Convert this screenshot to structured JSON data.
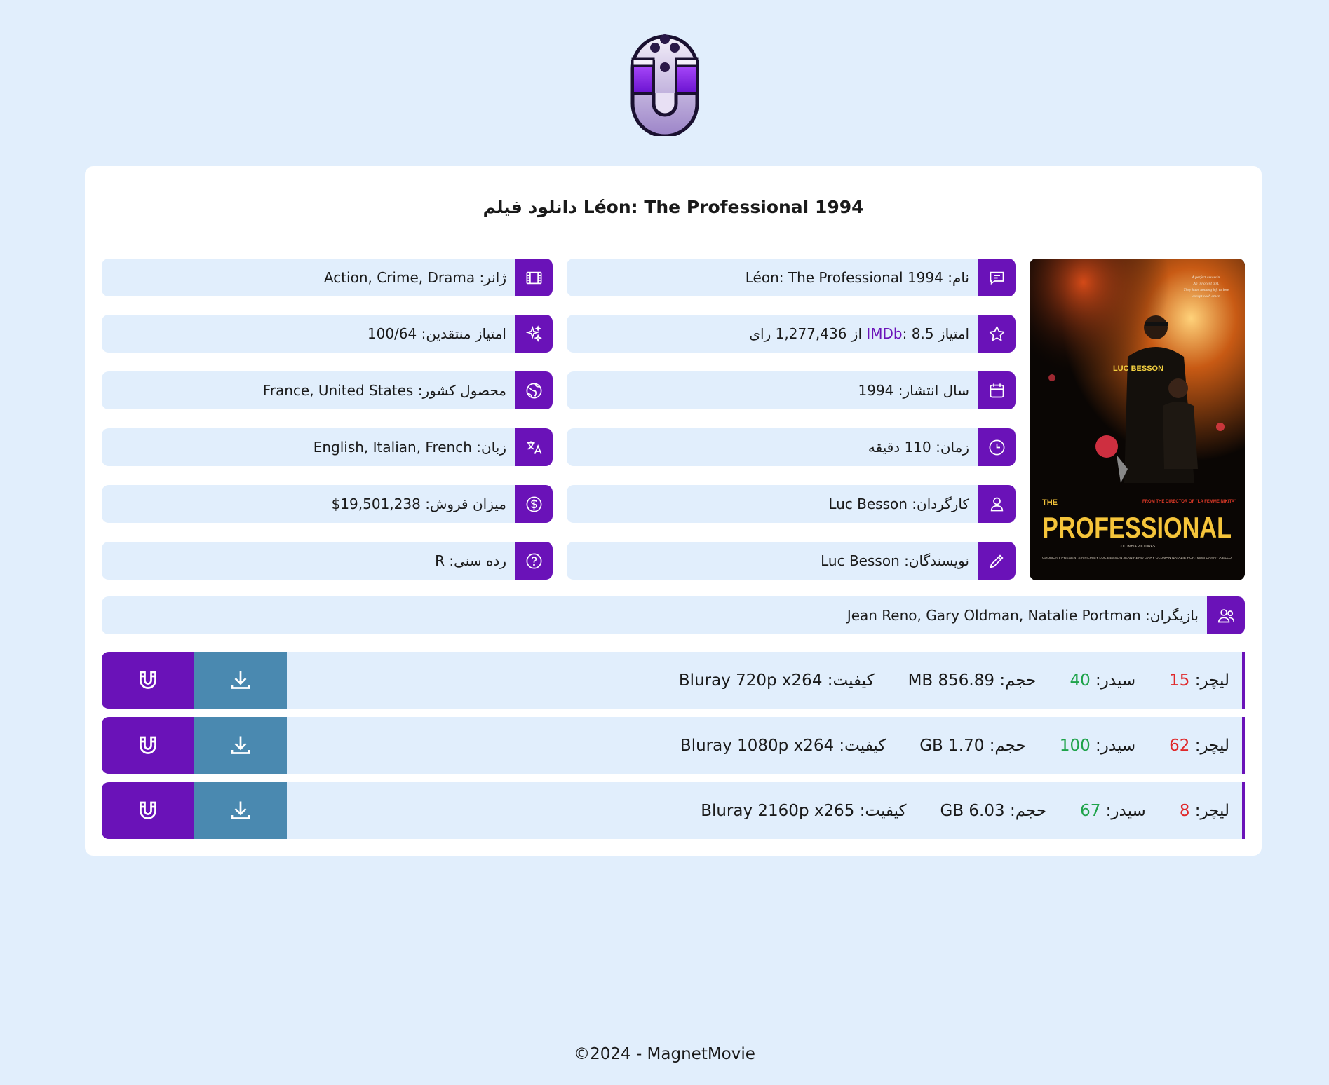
{
  "site": {
    "logo_icon": "film-reel-magnet-logo"
  },
  "page": {
    "title": "دانلود فیلم Léon: The Professional 1994"
  },
  "poster": {
    "top_lines": [
      "A perfect assassin.",
      "An innocent girl.",
      "They have nothing left to lose",
      "except each other."
    ],
    "director_credit": "LUC BESSON",
    "tagline": "FROM THE DIRECTOR OF \"LA FEMME NIKITA\"",
    "title_line1": "THE",
    "title_line2": "PROFESSIONAL",
    "billing": "GAUMONT PRESENTS  A FILM BY LUC BESSON  JEAN RENO  GARY OLDMAN  NATALIE PORTMAN  DANNY AIELLO",
    "credit_footer": "COLUMBIA PICTURES"
  },
  "info_right": [
    {
      "icon": "chat-icon",
      "label": "نام:",
      "value": "Léon: The Professional 1994"
    },
    {
      "icon": "star-icon",
      "label_pre": "امتیاز",
      "imdb": "IMDb",
      "label_post": ":",
      "value": "8.5 از 1,277,436 رای"
    },
    {
      "icon": "calendar-icon",
      "label": "سال انتشار:",
      "value": "1994"
    },
    {
      "icon": "clock-icon",
      "label": "زمان:",
      "value": "110 دقیقه"
    },
    {
      "icon": "person-icon",
      "label": "کارگردان:",
      "value": "Luc Besson"
    },
    {
      "icon": "pencil-icon",
      "label": "نویسندگان:",
      "value": "Luc Besson"
    }
  ],
  "info_left": [
    {
      "icon": "film-icon",
      "label": "ژانر:",
      "value": "Action, Crime, Drama"
    },
    {
      "icon": "sparkles-icon",
      "label": "امتیاز منتقدین:",
      "value": "100/64"
    },
    {
      "icon": "globe-icon",
      "label": "محصول کشور:",
      "value": "France, United States"
    },
    {
      "icon": "translate-icon",
      "label": "زبان:",
      "value": "English, Italian, French"
    },
    {
      "icon": "dollar-icon",
      "label": "میزان فروش:",
      "value": "$19,501,238"
    },
    {
      "icon": "question-icon",
      "label": "رده سنی:",
      "value": "R"
    }
  ],
  "cast": {
    "icon": "users-icon",
    "label": "بازیگران:",
    "value": "Jean Reno, Gary Oldman, Natalie Portman"
  },
  "downloads": [
    {
      "quality_label": "کیفیت:",
      "quality": "Bluray 720p x264",
      "size_label": "حجم:",
      "size": "856.89 MB",
      "seed_label": "سیدر:",
      "seeders": "40",
      "leech_label": "لیچر:",
      "leechers": "15"
    },
    {
      "quality_label": "کیفیت:",
      "quality": "Bluray 1080p x264",
      "size_label": "حجم:",
      "size": "1.70 GB",
      "seed_label": "سیدر:",
      "seeders": "100",
      "leech_label": "لیچر:",
      "leechers": "62"
    },
    {
      "quality_label": "کیفیت:",
      "quality": "Bluray 2160p x265",
      "size_label": "حجم:",
      "size": "6.03 GB",
      "seed_label": "سیدر:",
      "seeders": "67",
      "leech_label": "لیچر:",
      "leechers": "8"
    }
  ],
  "footer": {
    "text": "©2024 - MagnetMovie"
  },
  "colors": {
    "accent": "#6a12b8",
    "download": "#4a89b0",
    "background": "#e1eefc",
    "seeders": "#1ea34a",
    "leechers": "#e0282a"
  }
}
